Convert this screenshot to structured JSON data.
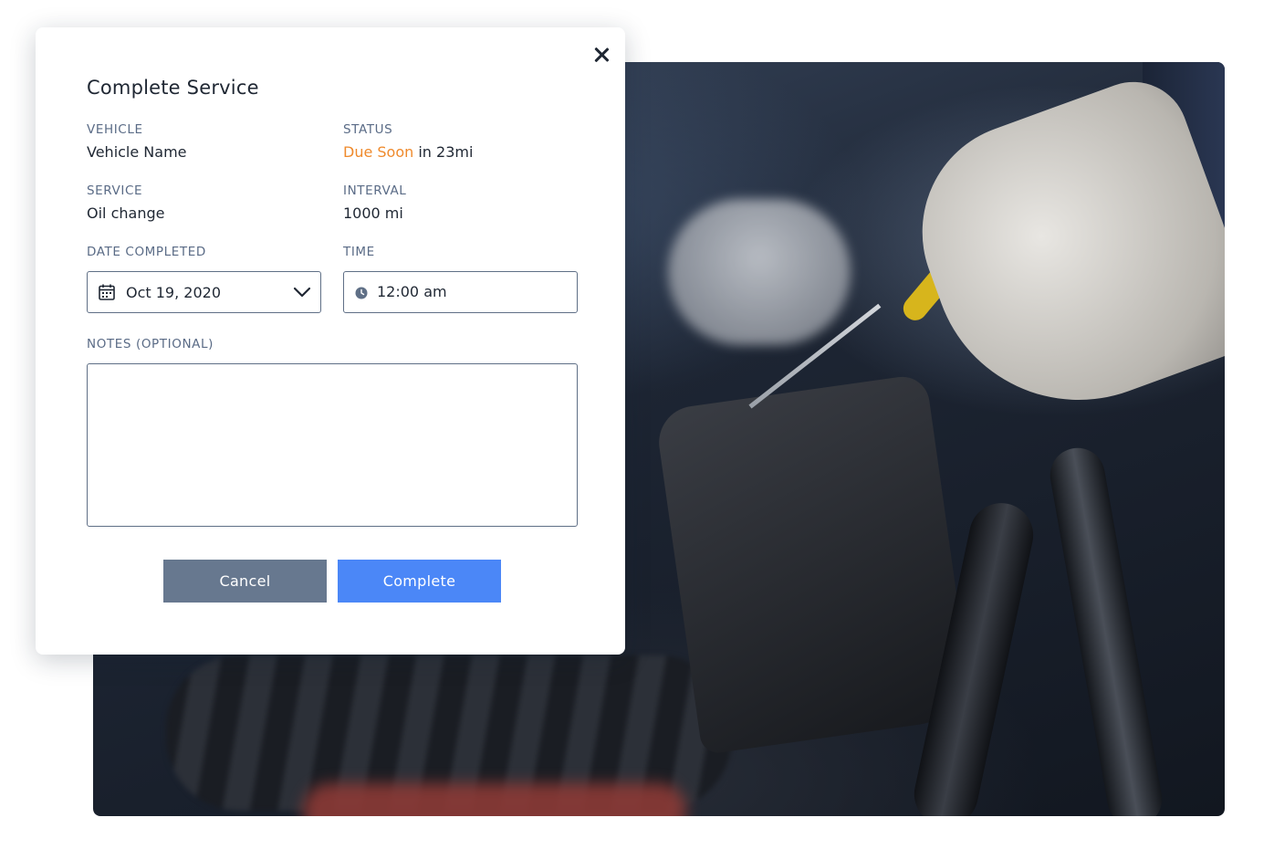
{
  "modal": {
    "title": "Complete Service",
    "vehicle": {
      "label": "VEHICLE",
      "value": "Vehicle Name"
    },
    "status": {
      "label": "STATUS",
      "highlight": "Due Soon",
      "rest": " in 23mi",
      "highlight_color": "#ef8a2c"
    },
    "service": {
      "label": "SERVICE",
      "value": "Oil change"
    },
    "interval": {
      "label": "INTERVAL",
      "value": "1000 mi"
    },
    "date_completed": {
      "label": "DATE COMPLETED",
      "value": "Oct 19, 2020"
    },
    "time": {
      "label": "TIME",
      "value": "12:00 am"
    },
    "notes": {
      "label": "NOTES (OPTIONAL)",
      "value": ""
    },
    "buttons": {
      "cancel": "Cancel",
      "complete": "Complete"
    }
  },
  "icons": {
    "close": "close-icon",
    "calendar": "calendar-icon",
    "chevron": "chevron-down-icon",
    "clock": "clock-icon"
  },
  "colors": {
    "complete_button": "#4b87f7",
    "cancel_button": "#67788f",
    "label_text": "#5a6b86"
  }
}
